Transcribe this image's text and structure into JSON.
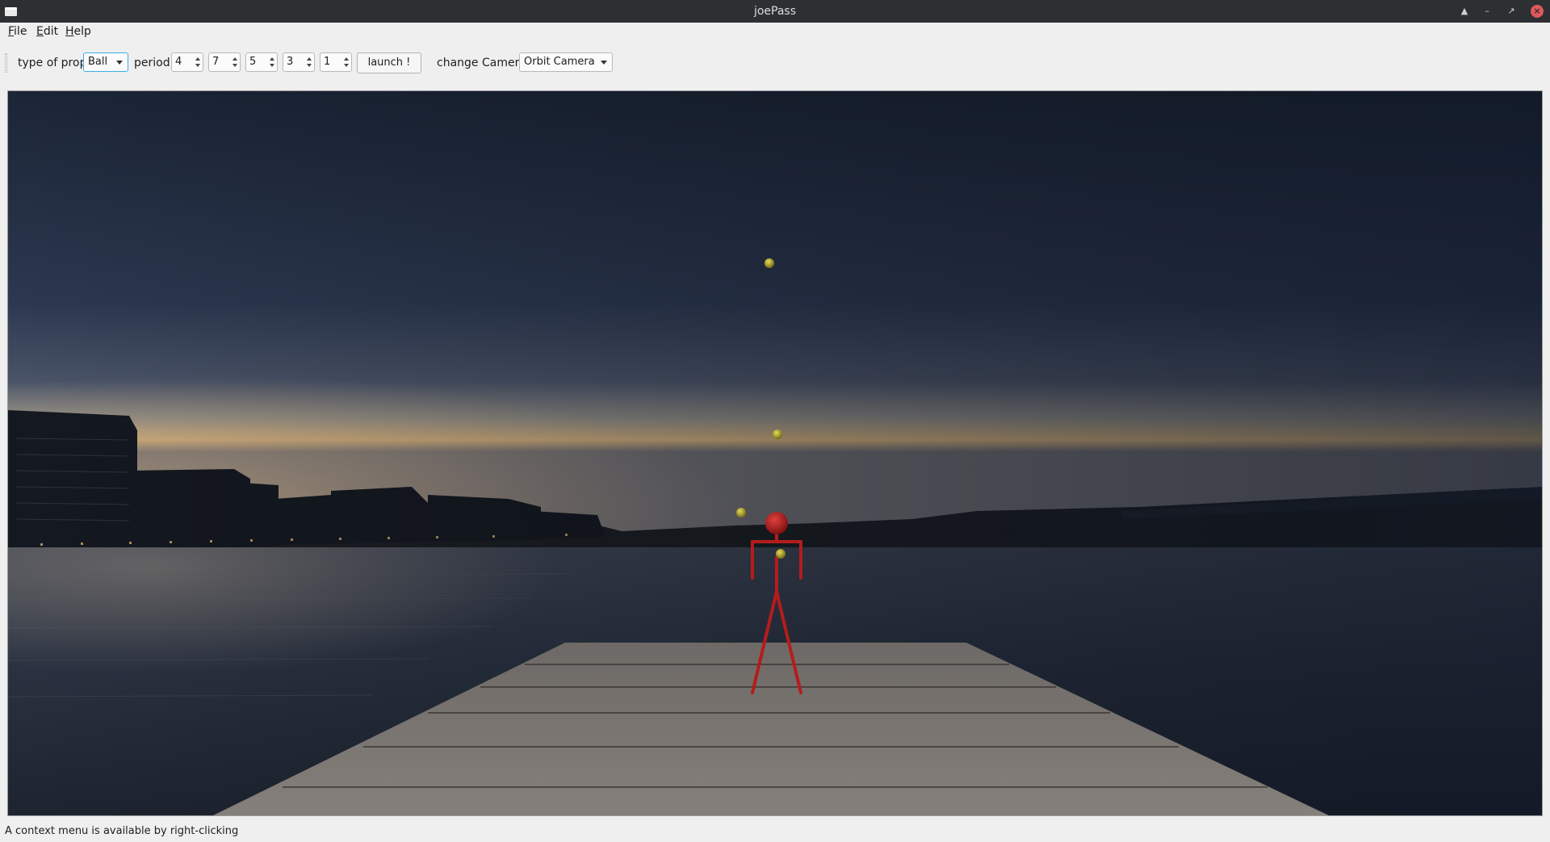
{
  "window": {
    "title": "joePass"
  },
  "menubar": {
    "items": [
      {
        "label": "F",
        "rest": "ile"
      },
      {
        "label": "E",
        "rest": "dit"
      },
      {
        "label": "H",
        "rest": "elp"
      }
    ]
  },
  "toolbar": {
    "prop_label": "type of prop",
    "prop_value": "Ball",
    "period_label": "period",
    "period_values": [
      "4",
      "7",
      "5",
      "3",
      "1"
    ],
    "launch_label": "launch !",
    "camera_label": "change Camera",
    "camera_value": "Orbit Camera"
  },
  "scene": {
    "juggler_color": "#b51c1c",
    "ball_color": "#b4a823",
    "sky_top": "#1b2536",
    "sky_horizon": "#c9a878"
  },
  "status": {
    "text": "A context menu is available by right-clicking"
  }
}
